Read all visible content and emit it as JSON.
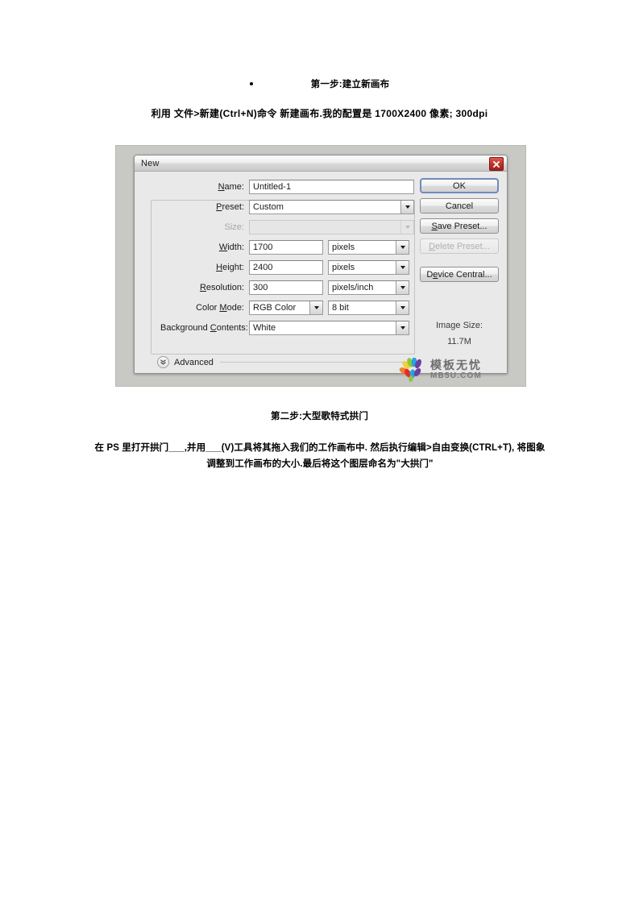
{
  "document": {
    "step1_heading": "第一步:建立新画布",
    "step1_paragraph": "利用 文件>新建(Ctrl+N)命令 新建画布.我的配置是 1700X2400 像素; 300dpi",
    "step2_heading": "第二步:大型歌特式拱门",
    "step2_paragraph_line1": "在 PS 里打开拱门___,并用___(V)工具将其拖入我们的工作画布中. 然后执行编辑>自由变换(CTRL+T),",
    "step2_paragraph_line2": "将图象调整到工作画布的大小.最后将这个图层命名为\"大拱门\""
  },
  "dialog": {
    "title": "New",
    "close_icon": "close-icon",
    "fields": {
      "name": {
        "label": "Name:",
        "label_accel": "N",
        "value": "Untitled-1"
      },
      "preset": {
        "label": "Preset:",
        "label_accel": "P",
        "value": "Custom"
      },
      "size": {
        "label": "Size:",
        "value": "",
        "disabled": true
      },
      "width": {
        "label": "Width:",
        "label_accel": "W",
        "value": "1700",
        "unit": "pixels"
      },
      "height": {
        "label": "Height:",
        "label_accel": "H",
        "value": "2400",
        "unit": "pixels"
      },
      "resolution": {
        "label": "Resolution:",
        "label_accel": "R",
        "value": "300",
        "unit": "pixels/inch"
      },
      "color_mode": {
        "label": "Color Mode:",
        "label_accel": "M",
        "value": "RGB Color",
        "depth": "8 bit"
      },
      "background_contents": {
        "label": "Background Contents:",
        "label_accel": "C",
        "value": "White"
      }
    },
    "advanced": {
      "label": "Advanced",
      "expanded": false
    },
    "buttons": {
      "ok": "OK",
      "cancel": "Cancel",
      "save_preset": "Save Preset...",
      "delete_preset": "Delete Preset...",
      "device_central": "Device Central..."
    },
    "image_size": {
      "label": "Image Size:",
      "value": "11.7M"
    }
  },
  "watermark": {
    "chinese": "模板无忧",
    "latin": "MB5U.COM"
  },
  "colors": {
    "dialog_bg": "#e9e9e9",
    "frame_bg": "#c8c8c4",
    "close_red": "#c0322b",
    "default_btn_border": "#6f8bbd"
  }
}
